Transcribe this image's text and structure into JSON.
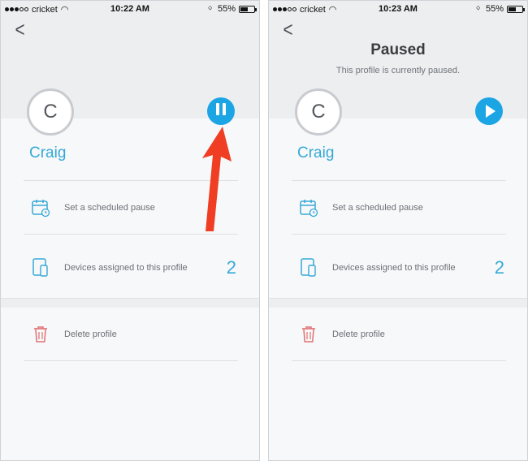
{
  "colors": {
    "accent": "#1ca5e4",
    "name": "#36a9d6",
    "arrow": "#ef3e23",
    "delete": "#e06f6f"
  },
  "screens": [
    {
      "status": {
        "carrier": "cricket",
        "time": "10:22 AM",
        "battery": "55%",
        "battery_level": 0.55
      },
      "back_icon": "chevron-left-icon",
      "avatar_initial": "C",
      "profile_name": "Craig",
      "action_icon": "pause-icon",
      "rows": {
        "schedule": {
          "label": "Set a scheduled pause",
          "icon": "calendar-clock-icon"
        },
        "devices": {
          "label": "Devices assigned to this profile",
          "count": "2",
          "icon": "devices-icon"
        },
        "delete": {
          "label": "Delete profile",
          "icon": "trash-icon"
        }
      }
    },
    {
      "status": {
        "carrier": "cricket",
        "time": "10:23 AM",
        "battery": "55%",
        "battery_level": 0.55
      },
      "back_icon": "chevron-left-icon",
      "paused_title": "Paused",
      "paused_subtitle": "This profile is currently paused.",
      "avatar_initial": "C",
      "profile_name": "Craig",
      "action_icon": "play-icon",
      "rows": {
        "schedule": {
          "label": "Set a scheduled pause",
          "icon": "calendar-clock-icon"
        },
        "devices": {
          "label": "Devices assigned to this profile",
          "count": "2",
          "icon": "devices-icon"
        },
        "delete": {
          "label": "Delete profile",
          "icon": "trash-icon"
        }
      }
    }
  ]
}
